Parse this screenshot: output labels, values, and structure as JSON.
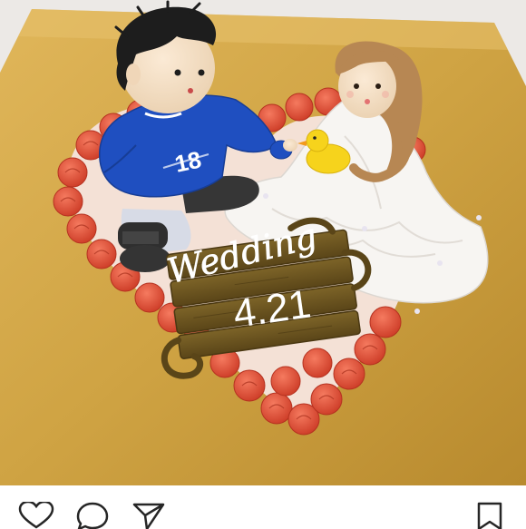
{
  "post": {
    "image": {
      "subject": "wedding-cake-topper",
      "sign_text_script": "Wedding",
      "sign_text_date": "4.21",
      "jersey_number": "18"
    }
  },
  "actions": {
    "like": {
      "icon": "heart-icon"
    },
    "comment": {
      "icon": "comment-icon"
    },
    "share": {
      "icon": "send-icon"
    },
    "save": {
      "icon": "bookmark-icon"
    }
  },
  "colors": {
    "board_gold": "#cfa343",
    "rose_red": "#e2543e",
    "jersey_blue": "#1f4fc0",
    "dress_white": "#f7f5f2",
    "wood_brown": "#6b5320",
    "icon_stroke": "#262626"
  }
}
